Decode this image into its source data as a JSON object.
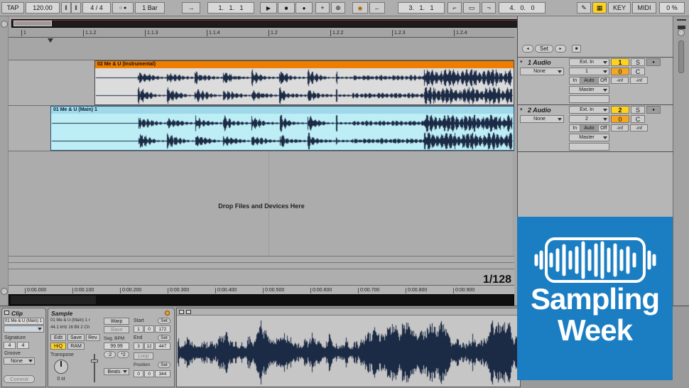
{
  "colors": {
    "clip1_header": "#ee7d00",
    "clip1_body": "#dcdcdc",
    "clip2_header": "#9fd8e8",
    "clip2_body": "#bdeef6",
    "waveform": "#1c2b45",
    "badge_blue": "#1b7ec2",
    "highlight_yellow": "#ffd21e",
    "value_orange": "#f5a623"
  },
  "toolbar": {
    "tap": "TAP",
    "tempo": "120.00",
    "nudge_down": "‖",
    "nudge_up": "‖",
    "signature": "4 / 4",
    "metro_a": "○",
    "metro_b": "●",
    "quantize": "1 Bar",
    "follow": "→",
    "position": "1.   1.   1",
    "play": "▶",
    "stop": "■",
    "record": "●",
    "plus": "+",
    "overdub": "⊕",
    "automation": "◉",
    "back": "←",
    "loop_start": "3.   1.   1",
    "punch_in": "⌐",
    "loop": "▭",
    "punch_out": "¬",
    "loop_length": "4.   0.   0",
    "pencil": "✎",
    "kbd": "▦",
    "key": "KEY",
    "midi": "MIDI",
    "cpu": "0 %"
  },
  "timeline": {
    "markers": [
      "1",
      "1.1.2",
      "1.1.3",
      "1.1.4",
      "1.2",
      "1.2.2",
      "1.2.3",
      "1.2.4"
    ]
  },
  "tracks": [
    {
      "clip_name": "02 Me & U (Instrumental)"
    },
    {
      "clip_name": "01 Me & U (Main) 1"
    }
  ],
  "arrangement": {
    "drop_hint": "Drop Files and Devices Here",
    "zoom": "1/128"
  },
  "time_ruler": [
    "0:00.000",
    "0:00.100",
    "0:00.200",
    "0:00.300",
    "0:00.400",
    "0:00.500",
    "0:00.600",
    "0:00.700",
    "0:00.800",
    "0:00.900"
  ],
  "mixer": {
    "prev": "◂",
    "set": "Set",
    "next": "▸",
    "stop_clips": "■",
    "tracks": [
      {
        "fold": "▾",
        "name": "1 Audio",
        "output_to": "None",
        "input_type": "Ext. In",
        "input_ch": "1",
        "mon_in": "In",
        "mon_auto": "Auto",
        "mon_off": "Off",
        "out": "Master",
        "num": "1",
        "solo": "S",
        "arm": "●",
        "pan": "0",
        "xfade": "C",
        "meter_l": "-inf",
        "meter_r": "-inf"
      },
      {
        "fold": "▾",
        "name": "2 Audio",
        "output_to": "None",
        "input_type": "Ext. In",
        "input_ch": "2",
        "mon_in": "In",
        "mon_auto": "Auto",
        "mon_off": "Off",
        "out": "Master",
        "num": "2",
        "solo": "S",
        "arm": "●",
        "pan": "0",
        "xfade": "C",
        "meter_l": "-inf",
        "meter_r": "-inf"
      }
    ]
  },
  "clip_panel": {
    "title": "Clip",
    "name": "01 Me & U (Main) 1",
    "signature_label": "Signature",
    "sig_num": "4",
    "sig_den": "4",
    "groove_label": "Groove",
    "groove": "None",
    "commit": "Commit"
  },
  "sample_panel": {
    "title": "Sample",
    "file": "01 Me & U (Main) 1 r",
    "format": "44.1 kHz 16 Bit 2 Ch",
    "edit": "Edit",
    "save": "Save",
    "rev": "Rev.",
    "hiq": "HiQ",
    "ram": "RAM",
    "transpose_label": "Transpose",
    "transpose": "0 st",
    "warp": "Warp",
    "slave": "Slave",
    "seg_bpm_label": "Seg. BPM",
    "seg_bpm": "99.99",
    "half": ":2",
    "dbl": "*2",
    "warp_mode": "Beats",
    "start_label": "Start",
    "end_label": "End",
    "position_label": "Position",
    "set": "Set",
    "loop": "Loop",
    "start": [
      "1",
      "0",
      "172"
    ],
    "end": [
      "3",
      "12",
      "447"
    ],
    "position": [
      "0",
      "0",
      "344"
    ]
  },
  "badge": {
    "line1": "Sampling",
    "line2": "Week"
  }
}
